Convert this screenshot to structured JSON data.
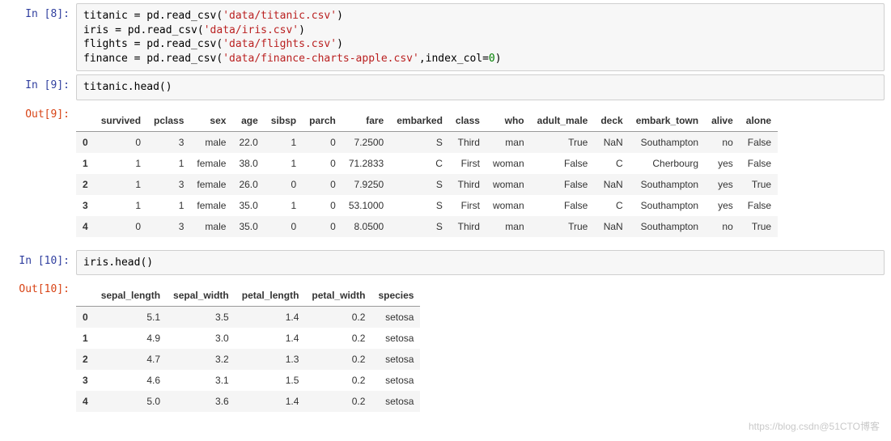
{
  "cells": [
    {
      "in_prompt": "In  [8]:",
      "code_segments": [
        {
          "t": "titanic = pd.read_csv("
        },
        {
          "t": "'data/titanic.csv'",
          "cls": "code-str"
        },
        {
          "t": ")\n"
        },
        {
          "t": "iris = pd.read_csv("
        },
        {
          "t": "'data/iris.csv'",
          "cls": "code-str"
        },
        {
          "t": ")\n"
        },
        {
          "t": "flights = pd.read_csv("
        },
        {
          "t": "'data/flights.csv'",
          "cls": "code-str"
        },
        {
          "t": ")\n"
        },
        {
          "t": "finance = pd.read_csv("
        },
        {
          "t": "'data/finance-charts-apple.csv'",
          "cls": "code-str"
        },
        {
          "t": ",index_col="
        },
        {
          "t": "0",
          "cls": "code-num"
        },
        {
          "t": ")"
        }
      ]
    },
    {
      "in_prompt": "In  [9]:",
      "code_segments": [
        {
          "t": "titanic.head()"
        }
      ],
      "out_prompt": "Out[9]:",
      "table": {
        "columns": [
          "survived",
          "pclass",
          "sex",
          "age",
          "sibsp",
          "parch",
          "fare",
          "embarked",
          "class",
          "who",
          "adult_male",
          "deck",
          "embark_town",
          "alive",
          "alone"
        ],
        "index": [
          "0",
          "1",
          "2",
          "3",
          "4"
        ],
        "rows": [
          [
            "0",
            "3",
            "male",
            "22.0",
            "1",
            "0",
            "7.2500",
            "S",
            "Third",
            "man",
            "True",
            "NaN",
            "Southampton",
            "no",
            "False"
          ],
          [
            "1",
            "1",
            "female",
            "38.0",
            "1",
            "0",
            "71.2833",
            "C",
            "First",
            "woman",
            "False",
            "C",
            "Cherbourg",
            "yes",
            "False"
          ],
          [
            "1",
            "3",
            "female",
            "26.0",
            "0",
            "0",
            "7.9250",
            "S",
            "Third",
            "woman",
            "False",
            "NaN",
            "Southampton",
            "yes",
            "True"
          ],
          [
            "1",
            "1",
            "female",
            "35.0",
            "1",
            "0",
            "53.1000",
            "S",
            "First",
            "woman",
            "False",
            "C",
            "Southampton",
            "yes",
            "False"
          ],
          [
            "0",
            "3",
            "male",
            "35.0",
            "0",
            "0",
            "8.0500",
            "S",
            "Third",
            "man",
            "True",
            "NaN",
            "Southampton",
            "no",
            "True"
          ]
        ]
      }
    },
    {
      "in_prompt": "In  [10]:",
      "code_segments": [
        {
          "t": "iris.head()"
        }
      ],
      "out_prompt": "Out[10]:",
      "table": {
        "columns": [
          "sepal_length",
          "sepal_width",
          "petal_length",
          "petal_width",
          "species"
        ],
        "index": [
          "0",
          "1",
          "2",
          "3",
          "4"
        ],
        "rows": [
          [
            "5.1",
            "3.5",
            "1.4",
            "0.2",
            "setosa"
          ],
          [
            "4.9",
            "3.0",
            "1.4",
            "0.2",
            "setosa"
          ],
          [
            "4.7",
            "3.2",
            "1.3",
            "0.2",
            "setosa"
          ],
          [
            "4.6",
            "3.1",
            "1.5",
            "0.2",
            "setosa"
          ],
          [
            "5.0",
            "3.6",
            "1.4",
            "0.2",
            "setosa"
          ]
        ]
      }
    }
  ],
  "watermark": "https://blog.csdn@51CTO博客"
}
